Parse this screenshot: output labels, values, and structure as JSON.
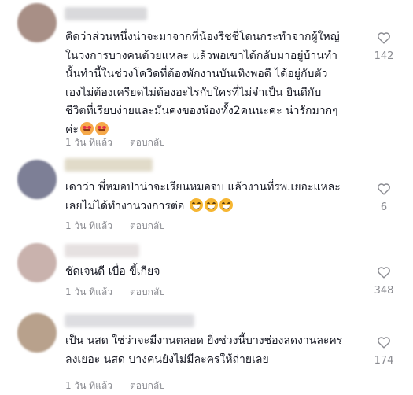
{
  "comments": [
    {
      "text": "คิดว่าส่วนหนึ่งน่าจะมาจากที่น้องริชชี่โดนกระทำจากผู้ใหญ่\nในวงการบางคนด้วยแหละ แล้วพอเขาได้กลับมาอยู่บ้านทำ\nนั้นทำนี้ในช่วงโควิดที่ต้องพักงานบันเทิงพอดี ได้อยู่กับตัว\nเองไม่ต้องเครียดไม่ต้องอะไรกับใครที่ไม่จำเป็น ยินดีกับ\nชีวิตที่เรียบง่ายและมั่นคงของน้องทั้ง2คนนะคะ น่ารักมากๆ\nค่ะ",
      "emojis": [
        "love-face-emoji",
        "love-face-emoji"
      ],
      "time": "1 วัน ที่แล้ว",
      "reply": "ตอบกลับ",
      "likes": "142",
      "avatar_color": "#a88f86",
      "name_color": "#d3d3d6"
    },
    {
      "text": "เดาว่า พี่หมอป่าน่าจะเรียนหมอจบ แล้วงานที่รพ.เยอะแหละ\nเลยไม่ได้ทำงานวงการต่อ",
      "emojis": [
        "grinning-face-emoji",
        "grinning-face-emoji",
        "grinning-face-emoji"
      ],
      "time": "1 วัน ที่แล้ว",
      "reply": "ตอบกลับ",
      "likes": "6",
      "avatar_color": "#7d7f96",
      "name_color": "#dcd5c0"
    },
    {
      "text": "ชัดเจนดี เบื่อ ขี้เกียจ",
      "emojis": [],
      "time": "1 วัน ที่แล้ว",
      "reply": "ตอบกลับ",
      "likes": "348",
      "avatar_color": "#c9b2ad",
      "name_color": "#e2dcdc"
    },
    {
      "text": "เป็น นสด ใช่ว่าจะมีงานตลอด ยิ่งช่วงนี้บางช่องลดงานละคร\nลงเยอะ นสด บางคนยังไม่มีละครให้ถ่ายเลย",
      "emojis": [],
      "time": "1 วัน ที่แล้ว",
      "reply": "ตอบกลับ",
      "likes": "174",
      "avatar_color": "#b8a18c",
      "name_color": "#d8d8dc"
    }
  ],
  "icons": {
    "like": "heart-outline-icon"
  }
}
